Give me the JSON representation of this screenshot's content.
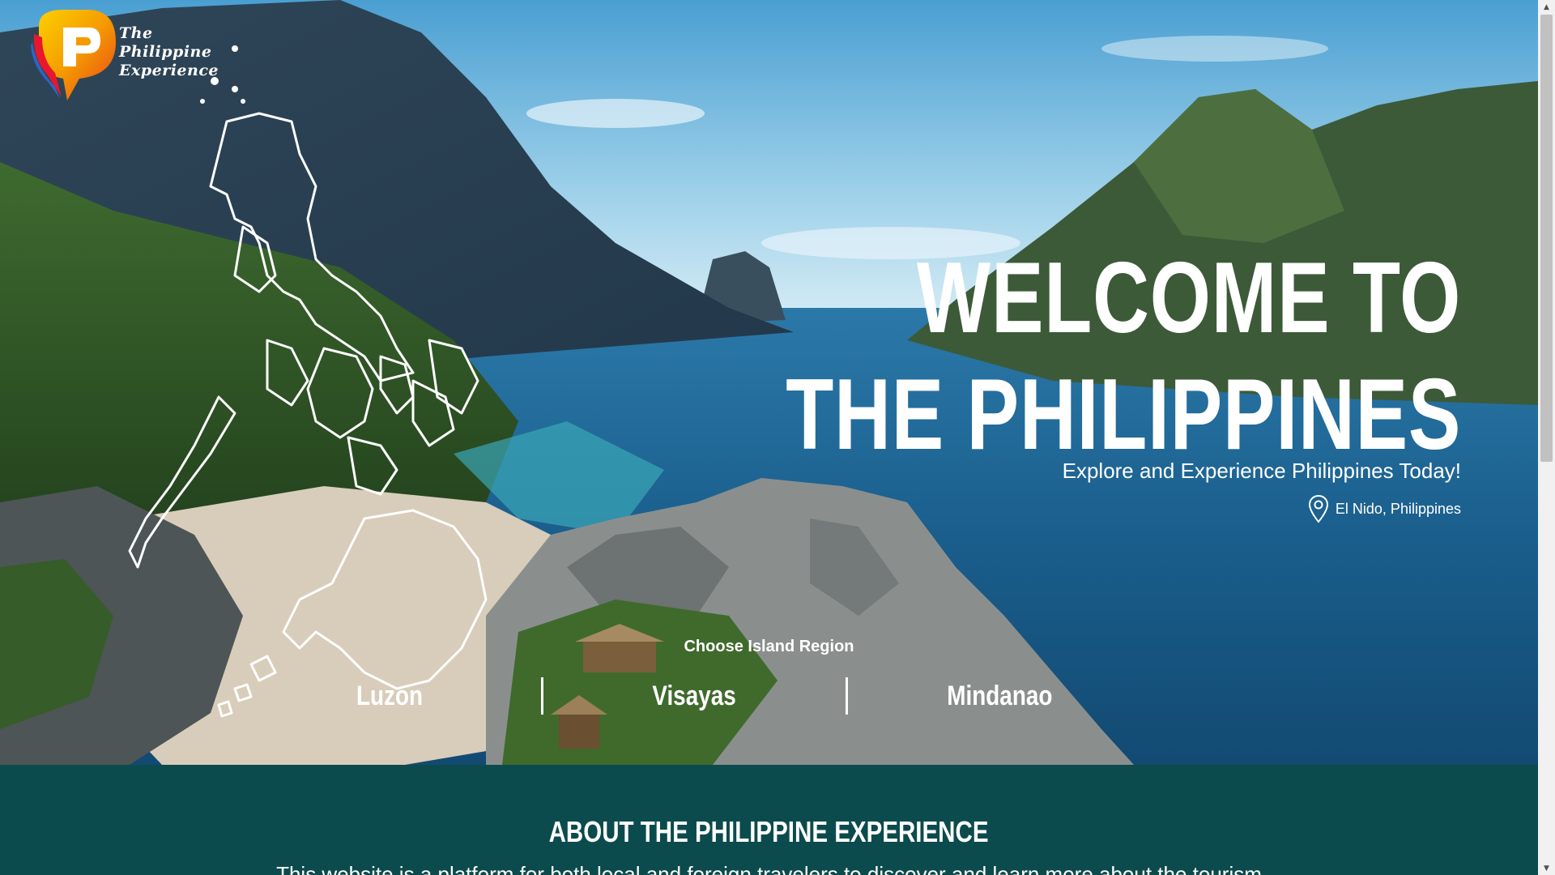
{
  "brand": {
    "logo_lines": [
      "The",
      "Philippine",
      "Experience"
    ]
  },
  "hero": {
    "headline_line1": "WELCOME TO",
    "headline_line2": "THE PHILIPPINES",
    "tagline": "Explore and Experience Philippines Today!",
    "location": "El Nido, Philippines",
    "choose_label": "Choose Island Region",
    "regions": [
      "Luzon",
      "Visayas",
      "Mindanao"
    ]
  },
  "about": {
    "title": "About the Philippine Experience",
    "body": "This website is a platform for both local and foreign travelers to discover and learn more about the tourism"
  },
  "icons": {
    "logo": "speech-bubble-logo-icon",
    "location": "map-pin-icon",
    "map": "philippines-map-outline"
  },
  "colors": {
    "about_bg": "#0c4b4d",
    "text": "#ffffff"
  }
}
